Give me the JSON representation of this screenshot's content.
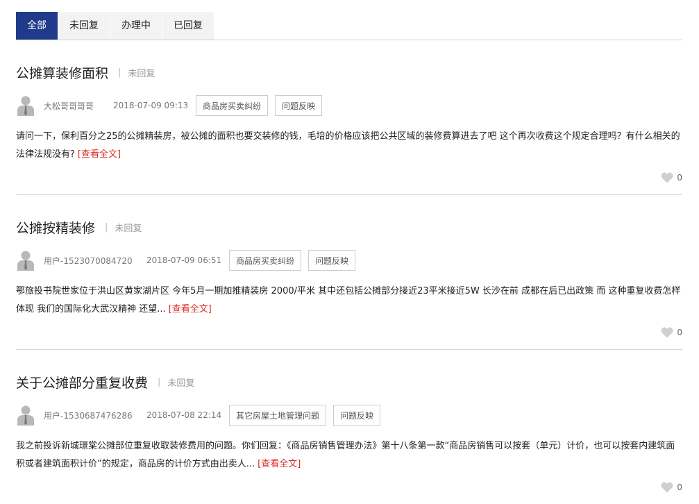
{
  "tabs": [
    {
      "label": "全部",
      "active": true
    },
    {
      "label": "未回复",
      "active": false
    },
    {
      "label": "办理中",
      "active": false
    },
    {
      "label": "已回复",
      "active": false
    }
  ],
  "posts": [
    {
      "title": "公摊算装修面积",
      "status": "未回复",
      "author": "大松哥哥哥哥",
      "date": "2018-07-09 09:13",
      "tags": [
        "商品房买卖纠纷",
        "问题反映"
      ],
      "excerpt": "请问一下，保利百分之25的公摊精装房，被公摊的面积也要交装修的钱，毛培的价格应该把公共区域的装修费算进去了吧 这个再次收费这个规定合理吗？有什么相关的法律法规没有?",
      "read_more": "[查看全文]",
      "likes": "0"
    },
    {
      "title": "公摊按精装修",
      "status": "未回复",
      "author": "用户-1523070084720",
      "date": "2018-07-09 06:51",
      "tags": [
        "商品房买卖纠纷",
        "问题反映"
      ],
      "excerpt": "鄂旅投书院世家位于洪山区黄家湖片区 今年5月一期加推精装房 2000/平米 其中还包括公摊部分接近23平米接近5W 长沙在前 成都在后已出政策 而 这种重复收费怎样体现 我们的国际化大武汉精神 还望...",
      "read_more": "[查看全文]",
      "likes": "0"
    },
    {
      "title": "关于公摊部分重复收费",
      "status": "未回复",
      "author": "用户-1530687476286",
      "date": "2018-07-08 22:14",
      "tags": [
        "其它房屋土地管理问题",
        "问题反映"
      ],
      "excerpt": "我之前投诉新城璟棠公摊部位重复收取装修费用的问题。你们回复：《商品房销售管理办法》第十八条第一款“商品房销售可以按套（单元）计价，也可以按套内建筑面积或者建筑面积计价”的规定，商品房的计价方式由出卖人...",
      "read_more": "[查看全文]",
      "likes": "0"
    }
  ],
  "colors": {
    "tab_active_bg": "#1f3a8a",
    "read_more": "#d9302a"
  },
  "icons": {
    "avatar": "user-silhouette-icon",
    "like": "heart-icon"
  }
}
